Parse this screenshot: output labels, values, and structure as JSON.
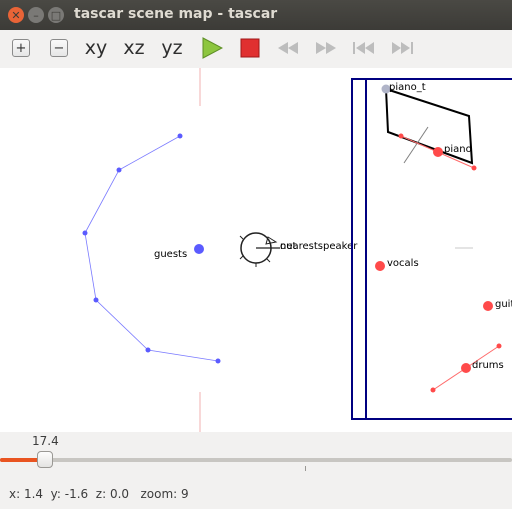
{
  "window": {
    "title": "tascar scene map - tascar"
  },
  "toolbar": {
    "zoom_in_icon": "+",
    "zoom_out_icon": "−",
    "view_xy": "xy",
    "view_xz": "xz",
    "view_yz": "yz",
    "icons": [
      "zoom-in-icon",
      "zoom-out-icon",
      "play-icon",
      "stop-icon",
      "rewind-icon",
      "forward-icon",
      "skip-start-icon",
      "skip-end-icon"
    ],
    "colors": {
      "play": "#8dc63f",
      "stop": "#e03030",
      "disabled": "#b8b8b8"
    }
  },
  "scene": {
    "guests_label": "guests",
    "receiver_label_1": "out",
    "receiver_label_2": "nearestspeaker",
    "piano_t_label": "piano_t",
    "piano_label": "piano",
    "vocals_label": "vocals",
    "guitar_label": "guit",
    "drums_label": "drums",
    "colors": {
      "guests": "#5b5bff",
      "source": "#ff4a4a",
      "frame": "#000080",
      "piano_t": "#b0b4c8"
    }
  },
  "timeline": {
    "value_label": "17.4",
    "progress": 0.087
  },
  "status": {
    "text": "x: 1.4  y: -1.6  z: 0.0   zoom: 9"
  }
}
